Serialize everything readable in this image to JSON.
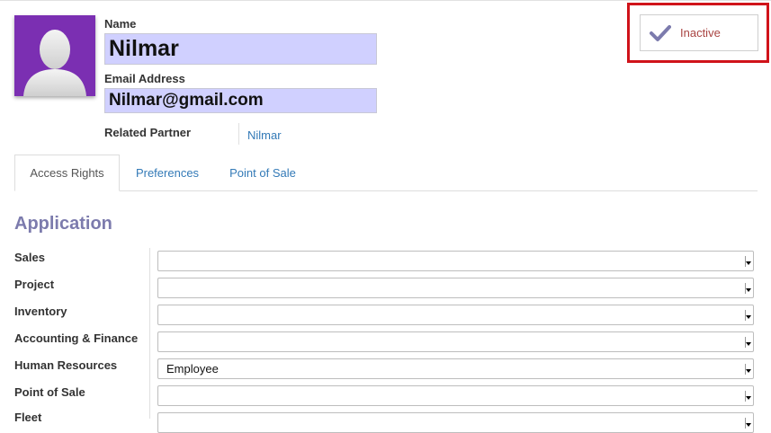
{
  "user": {
    "name_label": "Name",
    "name_value": "Nilmar",
    "email_label": "Email Address",
    "email_value": "Nilmar@gmail.com",
    "partner_label": "Related Partner",
    "partner_value": "Nilmar"
  },
  "status": {
    "label": "Inactive",
    "icon": "check-icon",
    "color": "#a94442",
    "highlight_color": "#d0131a"
  },
  "tabs": [
    {
      "label": "Access Rights",
      "active": true
    },
    {
      "label": "Preferences",
      "active": false
    },
    {
      "label": "Point of Sale",
      "active": false
    }
  ],
  "section": {
    "title": "Application"
  },
  "rights": [
    {
      "label": "Sales",
      "value": ""
    },
    {
      "label": "Project",
      "value": ""
    },
    {
      "label": "Inventory",
      "value": ""
    },
    {
      "label": "Accounting & Finance",
      "value": ""
    },
    {
      "label": "Human Resources",
      "value": "Employee"
    },
    {
      "label": "Point of Sale",
      "value": ""
    },
    {
      "label": "Fleet",
      "value": ""
    }
  ]
}
